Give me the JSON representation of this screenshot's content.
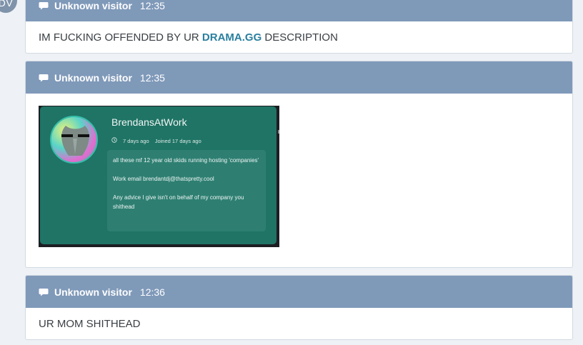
{
  "avatar_initials": "DV",
  "messages": [
    {
      "author": "Unknown visitor",
      "time": "12:35",
      "text_before": "IM FUCKING OFFENDED BY UR ",
      "link": "DRAMA.GG",
      "text_after": " DESCRIPTION"
    },
    {
      "author": "Unknown visitor",
      "time": "12:35",
      "embed": {
        "username": "BrendansAtWork",
        "age": "7 days ago",
        "joined": "Joined 17 days ago",
        "bio_lines": [
          "all these mf 12 year old skids running hosting 'companies'",
          "Work email brendantdj@thatspretty.cool",
          "Any advice I give isn't on behalf of my company you shithead"
        ]
      }
    },
    {
      "author": "Unknown visitor",
      "time": "12:36",
      "text": "UR MOM SHITHEAD"
    }
  ],
  "colors": {
    "header": "#7f99b9",
    "link": "#2a7f9f",
    "embed_card": "#1f7465"
  }
}
